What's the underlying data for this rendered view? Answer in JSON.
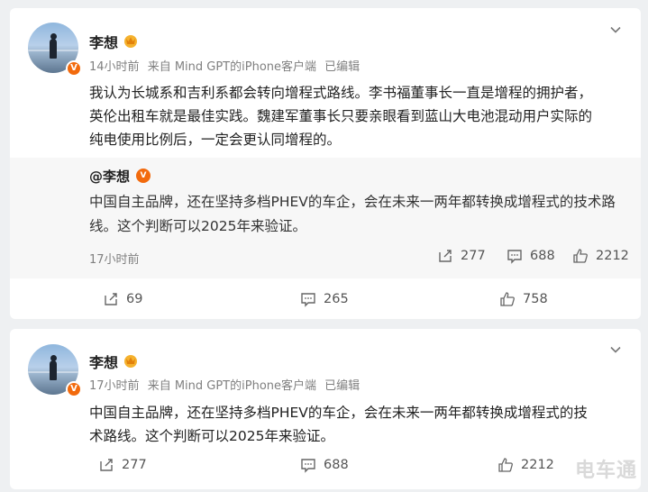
{
  "post1": {
    "username": "李想",
    "verified_mark": "V",
    "time": "14小时前",
    "source": "来自 Mind GPT的iPhone客户端",
    "edited": "已编辑",
    "text_lines": [
      "我认为长城系和吉利系都会转向增程式路线。李书福董事长一直是增程的拥护者，",
      "英伦出租车就是最佳实践。魏建军董事长只要亲眼看到蓝山大电池混动用户实际的",
      "纯电使用比例后，一定会更认同增程的。"
    ],
    "quoted": {
      "username": "@李想",
      "verified_mark": "V",
      "text_lines": [
        "中国自主品牌，还在坚持多档PHEV的车企，会在未来一两年都转换成增程式的技术路",
        "线。这个判断可以2025年来验证。"
      ],
      "time": "17小时前",
      "reposts": "277",
      "comments": "688",
      "likes": "2212"
    },
    "reposts": "69",
    "comments": "265",
    "likes": "758"
  },
  "post2": {
    "username": "李想",
    "verified_mark": "V",
    "time": "17小时前",
    "source": "来自 Mind GPT的iPhone客户端",
    "edited": "已编辑",
    "text_lines": [
      "中国自主品牌，还在坚持多档PHEV的车企，会在未来一两年都转换成增程式的技",
      "术路线。这个判断可以2025年来验证。"
    ],
    "reposts": "277",
    "comments": "688",
    "likes": "2212"
  },
  "watermark": "电车通",
  "colors": {
    "page_bg": "#eef0f2",
    "card_bg": "#ffffff",
    "quote_bg": "#f7f7f7",
    "verified_orange": "#f26a0d",
    "meta_gray": "#808080"
  },
  "icons": [
    "chevron-down-icon",
    "repost-icon",
    "comment-icon",
    "like-icon",
    "crown-badge-icon",
    "verified-badge-icon"
  ]
}
